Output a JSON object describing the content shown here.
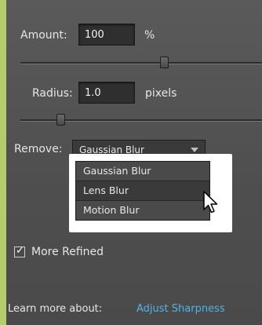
{
  "amount": {
    "label": "Amount:",
    "value": "100",
    "unit": "%",
    "slider_level": 0.62
  },
  "radius": {
    "label": "Radius:",
    "value": "1.0",
    "unit": "pixels",
    "slider_level": 0.22
  },
  "remove": {
    "label": "Remove:",
    "selected": "Gaussian Blur",
    "options": [
      "Gaussian Blur",
      "Lens Blur",
      "Motion Blur"
    ],
    "highlighted_index": 1
  },
  "more_refined": {
    "label": "More Refined",
    "checked": true
  },
  "footer": {
    "learn_more": "Learn more about:",
    "link": "Adjust Sharpness"
  }
}
